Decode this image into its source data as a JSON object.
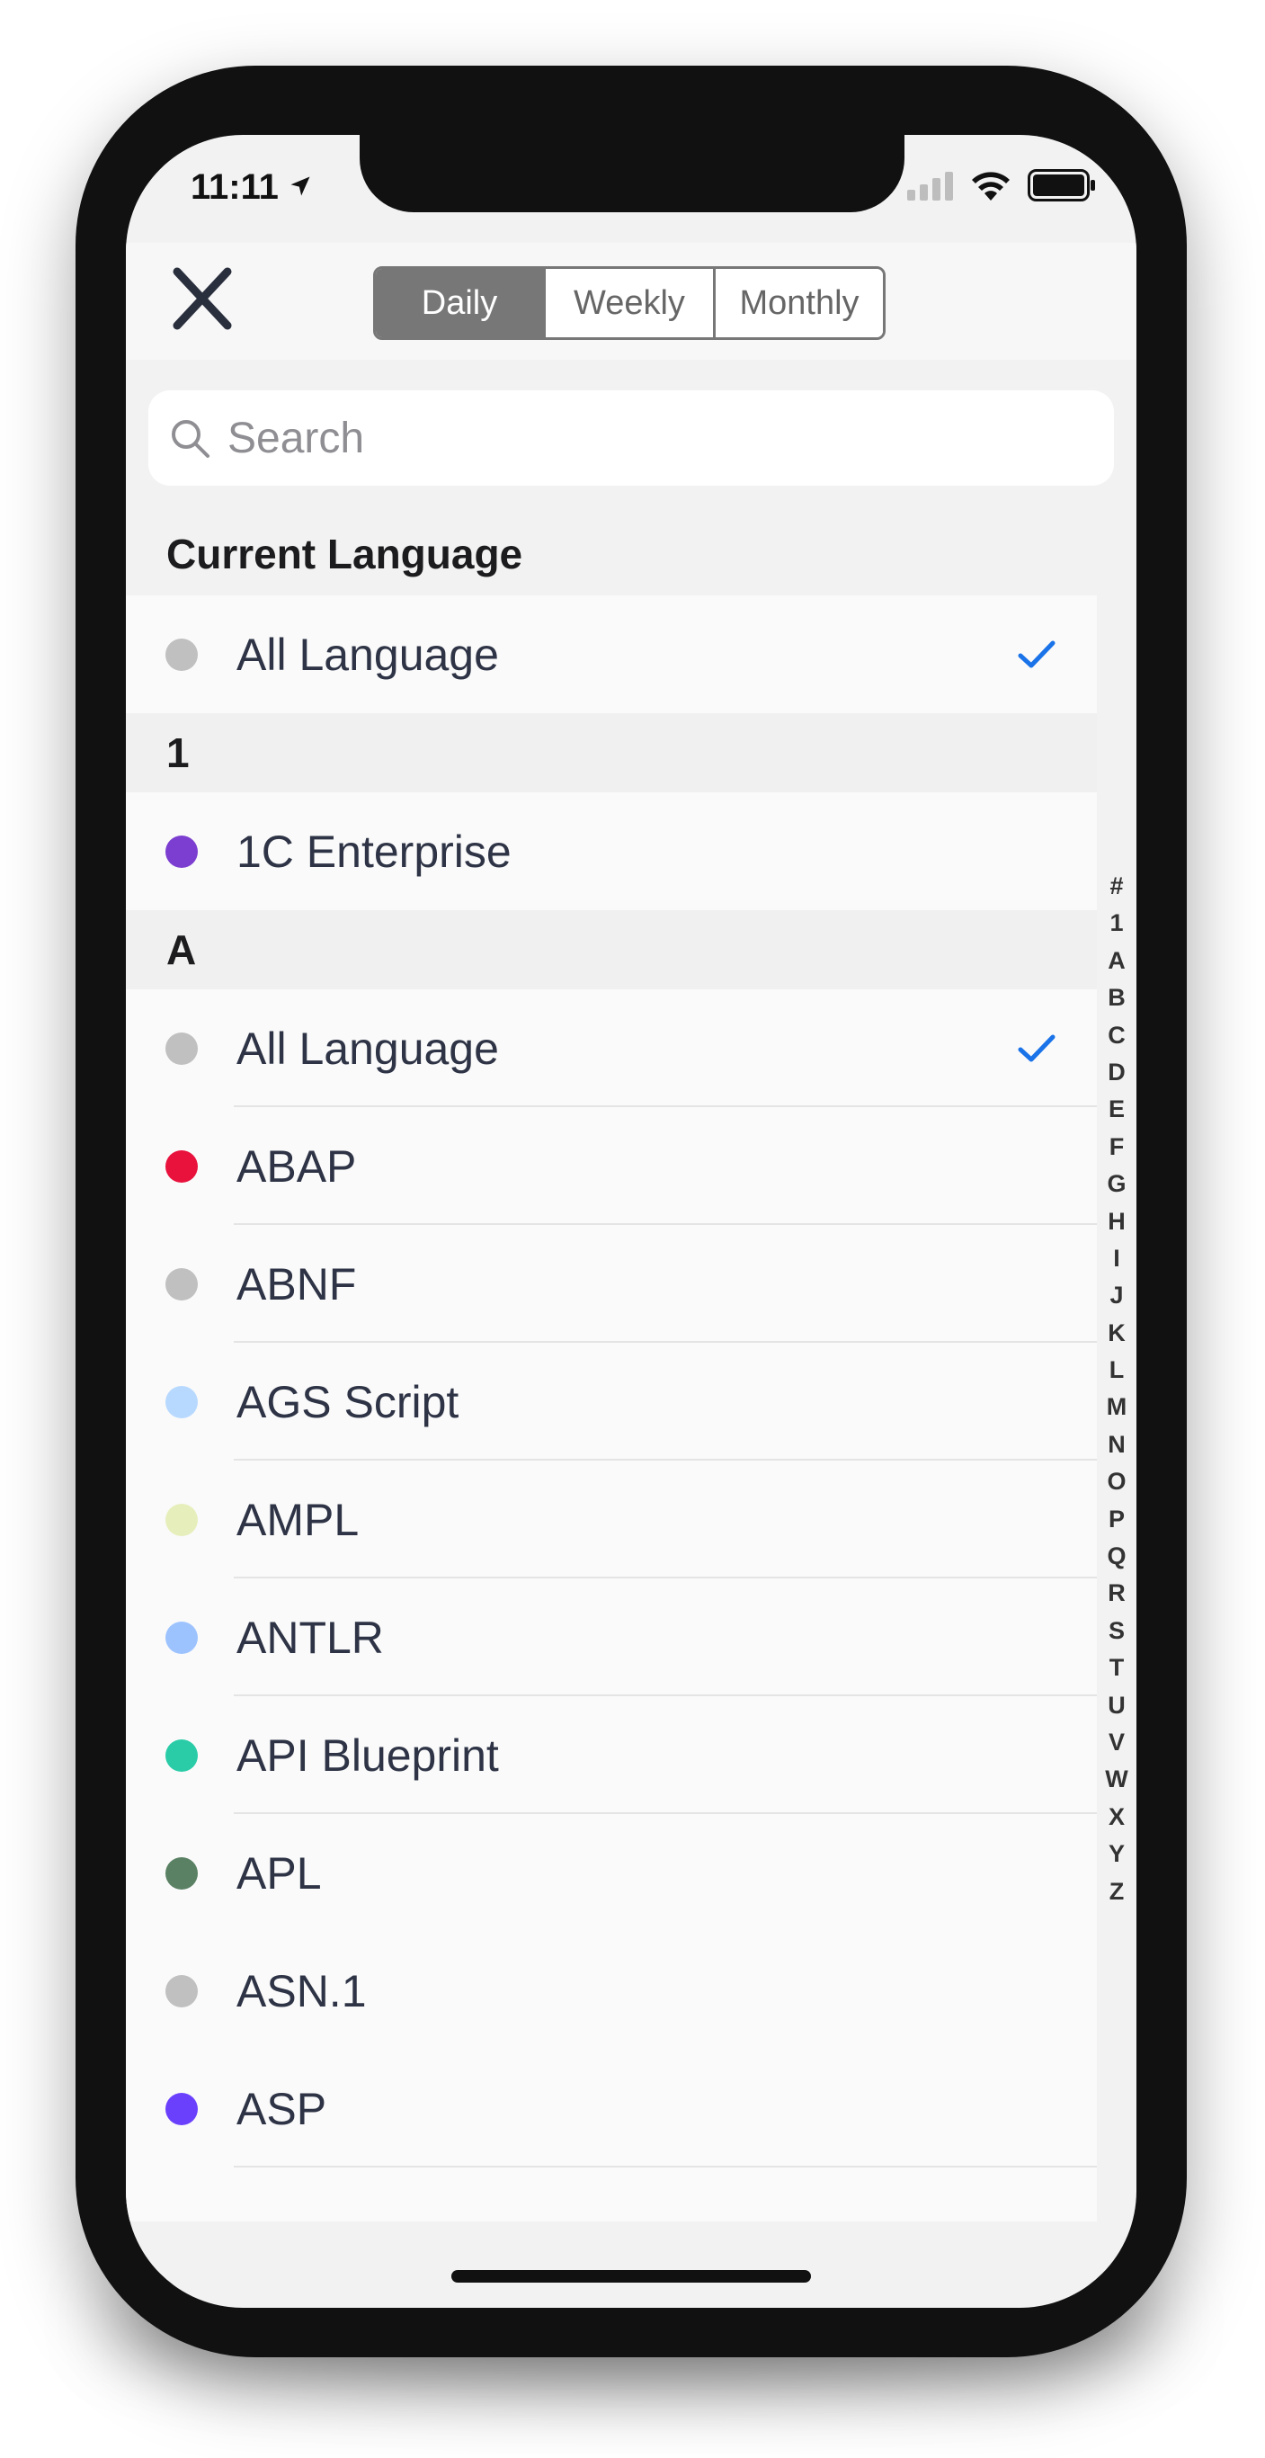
{
  "status_bar": {
    "time": "11:11"
  },
  "header": {
    "close_icon": "close-x-icon",
    "segments": [
      "Daily",
      "Weekly",
      "Monthly"
    ],
    "active_segment": "Daily"
  },
  "search": {
    "placeholder": "Search",
    "value": ""
  },
  "sections": [
    {
      "title": "Current Language",
      "rows": [
        {
          "label": "All Language",
          "color": "#c0c0c0",
          "checked": true
        }
      ]
    },
    {
      "title": "1",
      "rows": [
        {
          "label": "1C Enterprise",
          "color": "#7b3ed0",
          "checked": false
        }
      ]
    },
    {
      "title": "A",
      "rows": [
        {
          "label": "All Language",
          "color": "#c0c0c0",
          "checked": true
        },
        {
          "label": "ABAP",
          "color": "#e8123d",
          "checked": false
        },
        {
          "label": "ABNF",
          "color": "#c0c0c0",
          "checked": false
        },
        {
          "label": "AGS Script",
          "color": "#b8d9ff",
          "checked": false
        },
        {
          "label": "AMPL",
          "color": "#e6efbb",
          "checked": false
        },
        {
          "label": "ANTLR",
          "color": "#9dc3ff",
          "checked": false
        },
        {
          "label": "API Blueprint",
          "color": "#2acca8",
          "checked": false
        },
        {
          "label": "APL",
          "color": "#5a8164",
          "checked": false
        },
        {
          "label": "ASN.1",
          "color": "#c0c0c0",
          "checked": false
        },
        {
          "label": "ASP",
          "color": "#6a40fd",
          "checked": false
        }
      ]
    }
  ],
  "index_letters": [
    "#",
    "1",
    "A",
    "B",
    "C",
    "D",
    "E",
    "F",
    "G",
    "H",
    "I",
    "J",
    "K",
    "L",
    "M",
    "N",
    "O",
    "P",
    "Q",
    "R",
    "S",
    "T",
    "U",
    "V",
    "W",
    "X",
    "Y",
    "Z"
  ],
  "colors": {
    "accent": "#1a73e8",
    "segment_active": "#777777"
  }
}
